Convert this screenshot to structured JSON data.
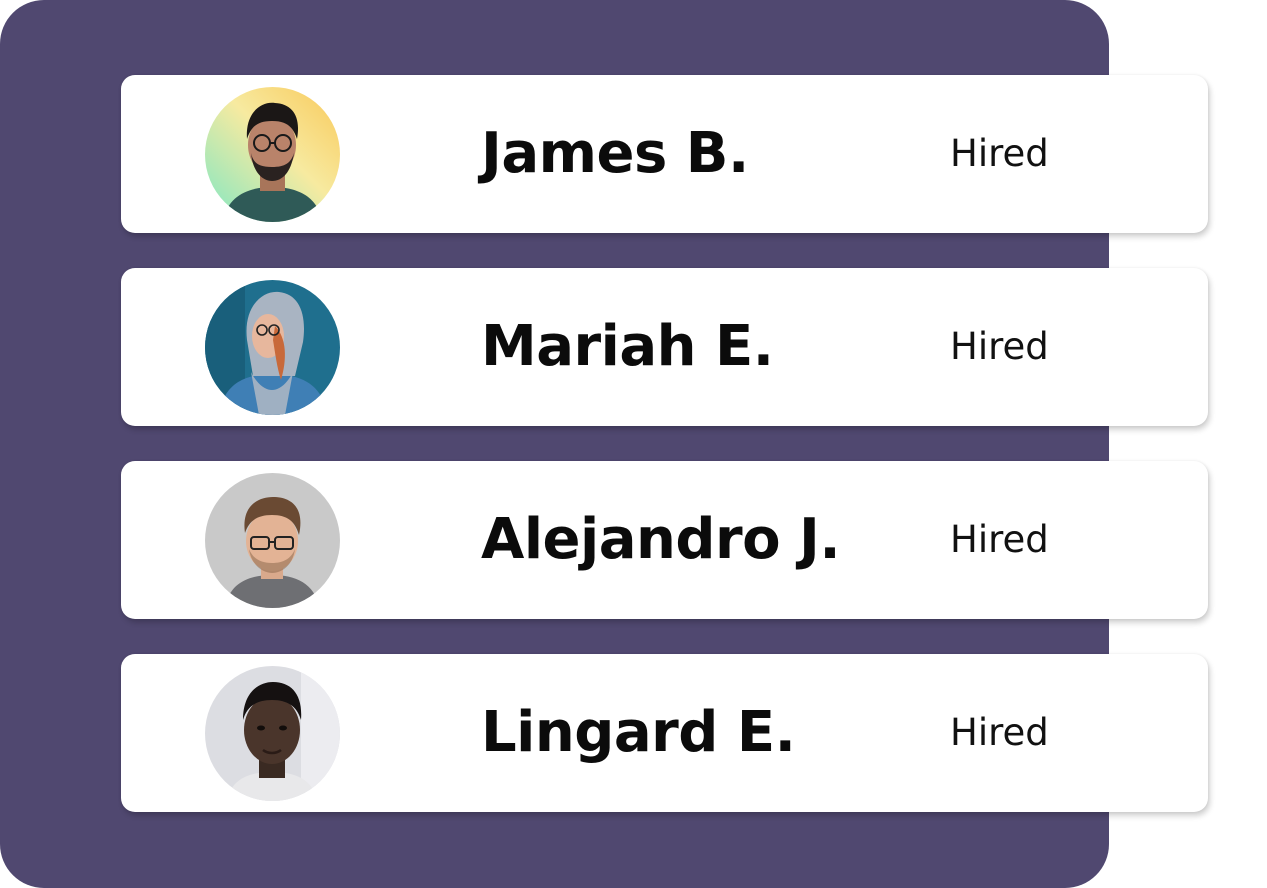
{
  "colors": {
    "panel_background": "#504870",
    "card_background": "#ffffff",
    "name_text": "#0b0b0b",
    "status_text": "#111111"
  },
  "candidates": [
    {
      "name": "James B.",
      "status": "Hired",
      "avatar": "person-avatar-icon"
    },
    {
      "name": "Mariah E.",
      "status": "Hired",
      "avatar": "person-avatar-icon"
    },
    {
      "name": "Alejandro J.",
      "status": "Hired",
      "avatar": "person-avatar-icon"
    },
    {
      "name": "Lingard E.",
      "status": "Hired",
      "avatar": "person-avatar-icon"
    }
  ]
}
